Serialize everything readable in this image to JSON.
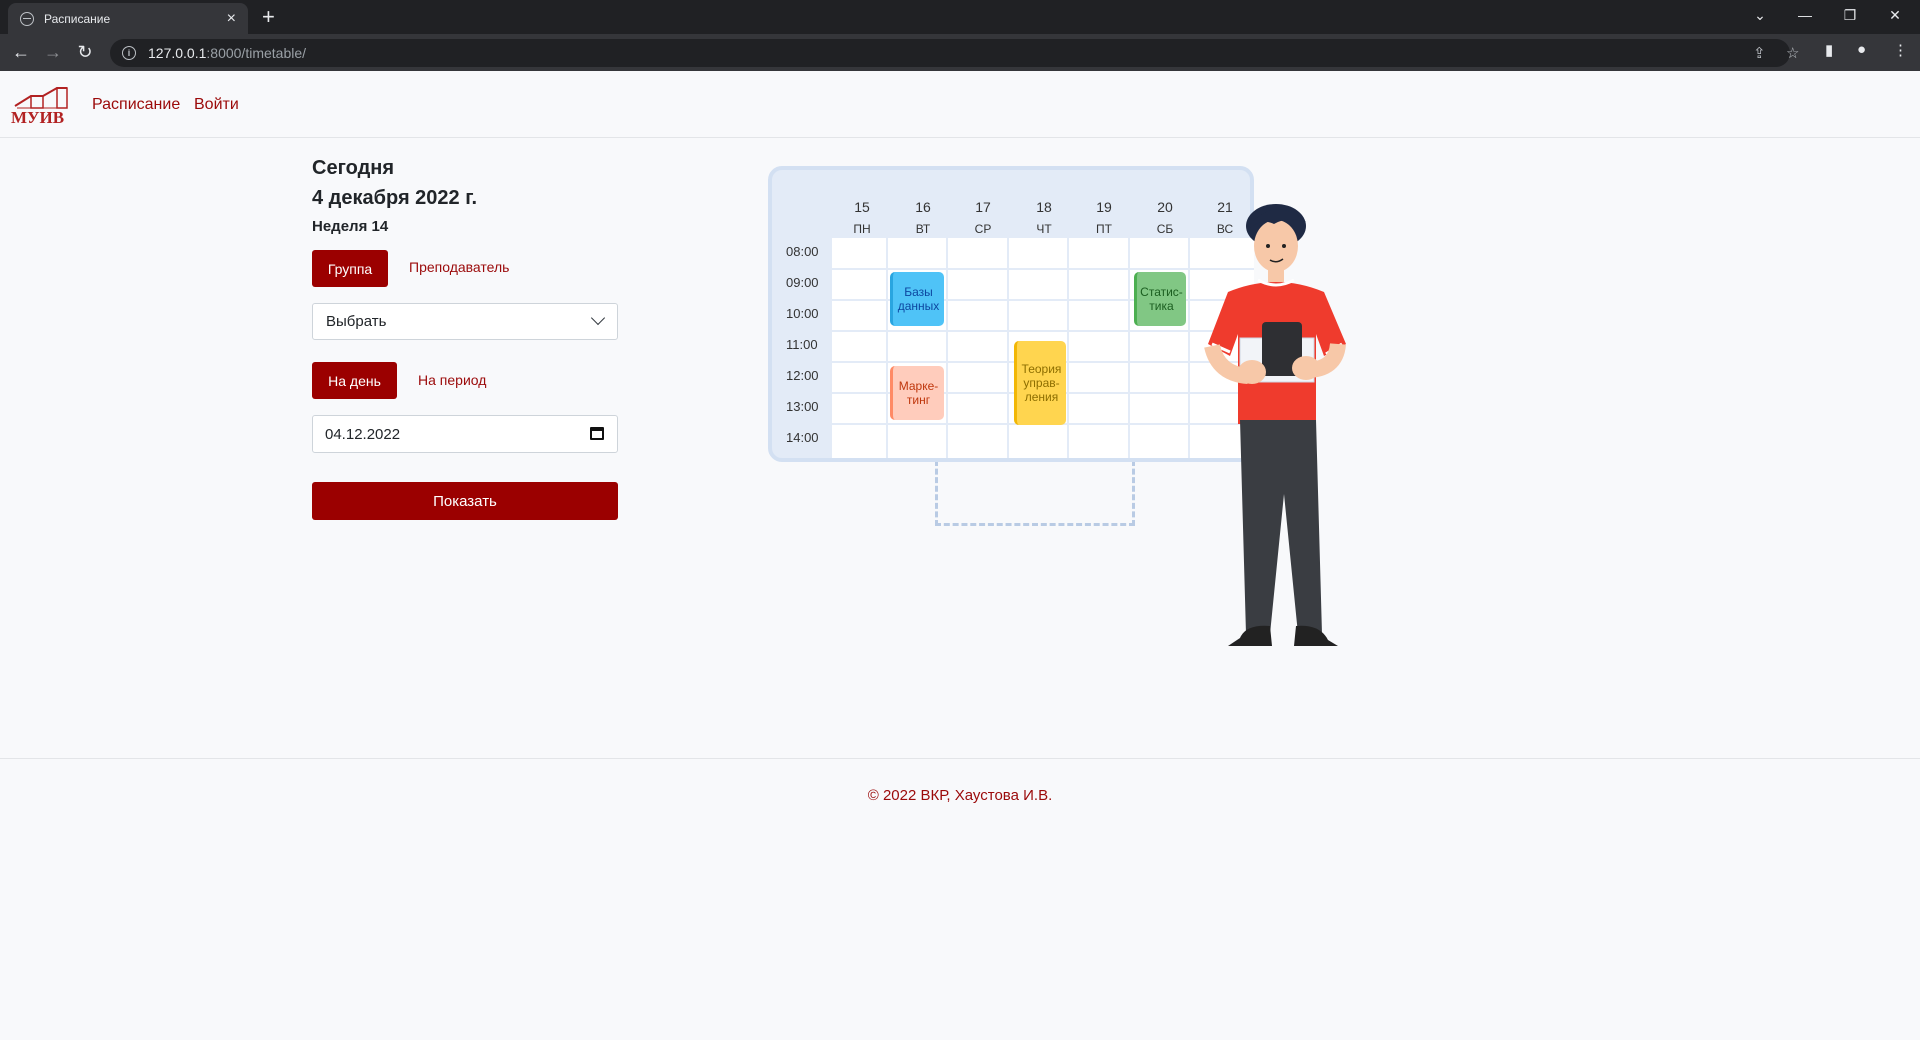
{
  "browser": {
    "tab_title": "Расписание",
    "tab_close": "×",
    "new_tab": "+",
    "url_host": "127.0.0.1",
    "url_rest": ":8000/timetable/"
  },
  "nav": {
    "logo_text": "МУИВ",
    "links": [
      "Расписание",
      "Войти"
    ]
  },
  "header": {
    "today_label": "Сегодня",
    "date": "4 декабря 2022 г.",
    "week": "Неделя 14"
  },
  "form": {
    "mode_tabs": [
      "Группа",
      "Преподаватель"
    ],
    "group_select": "Выбрать",
    "range_tabs": [
      "На день",
      "На период"
    ],
    "date_value": "04.12.2022",
    "submit_label": "Показать"
  },
  "illustration": {
    "days": [
      {
        "num": "15",
        "wd": "ПН"
      },
      {
        "num": "16",
        "wd": "ВТ"
      },
      {
        "num": "17",
        "wd": "СР"
      },
      {
        "num": "18",
        "wd": "ЧТ"
      },
      {
        "num": "19",
        "wd": "ПТ"
      },
      {
        "num": "20",
        "wd": "СБ"
      },
      {
        "num": "21",
        "wd": "ВС"
      }
    ],
    "times": [
      "08:00",
      "09:00",
      "10:00",
      "11:00",
      "12:00",
      "13:00",
      "14:00"
    ],
    "lessons": [
      {
        "text": "Базы данных",
        "color": "#4fc3f7",
        "text_color": "#0d47a1"
      },
      {
        "text": "Статис-тика",
        "color": "#66bb6a",
        "text_color": "#1b5e20"
      },
      {
        "text": "Теория управ-ления",
        "color": "#ffd54f",
        "text_color": "#8d6e00"
      },
      {
        "text": "Марке-тинг",
        "color": "#ffab91",
        "text_color": "#bf360c"
      }
    ]
  },
  "footer": {
    "copyright": "© 2022 ВКР, Хаустова И.В."
  },
  "colors": {
    "brand": "#9b0000",
    "link": "#9b0a0a",
    "background": "#f8f9fb"
  }
}
